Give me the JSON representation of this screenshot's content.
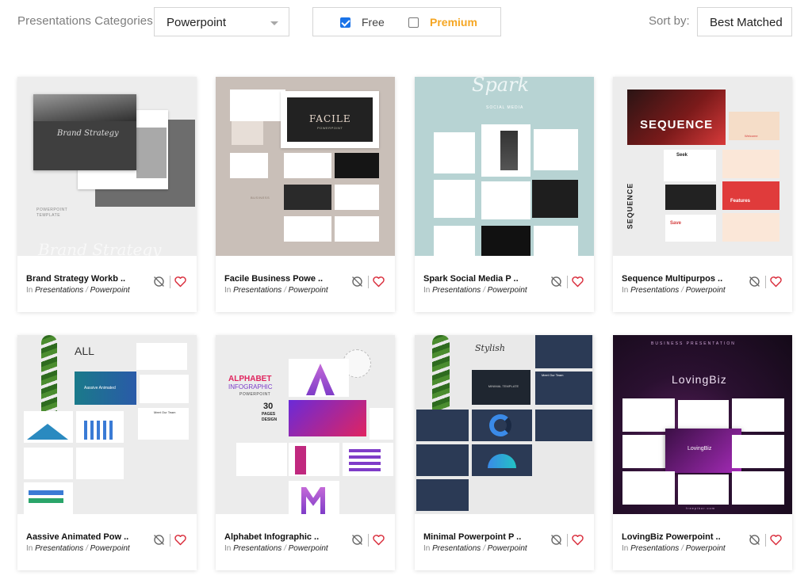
{
  "filters": {
    "category_label": "Presentations Categories",
    "category_value": "Powerpoint",
    "free_label": "Free",
    "free_checked": true,
    "premium_label": "Premium",
    "premium_checked": false,
    "premium_color": "#f5a623",
    "checkbox_color": "#1a73e8",
    "sort_label": "Sort by:",
    "sort_value": "Best Matched"
  },
  "cards": [
    {
      "title": "Brand Strategy Workb ..",
      "in_label": "In",
      "category": "Presentations",
      "separator": "/",
      "subcategory": "Powerpoint",
      "thumb": {
        "bg": "#ededed",
        "cover_script": "Brand Strategy",
        "tag_lines": [
          "POWERPOINT",
          "TEMPLATE"
        ],
        "watermark": "Brand Strategy"
      }
    },
    {
      "title": "Facile Business Powe ..",
      "in_label": "In",
      "category": "Presentations",
      "separator": "/",
      "subcategory": "Powerpoint",
      "thumb": {
        "bg": "#c9bfb8",
        "cover_title": "FACILE",
        "cover_sub": "POWERPOINT",
        "label": "BUSINESS"
      }
    },
    {
      "title": "Spark Social Media P ..",
      "in_label": "In",
      "category": "Presentations",
      "separator": "/",
      "subcategory": "Powerpoint",
      "thumb": {
        "bg": "#b7d3d3",
        "cover_title": "Spark",
        "cover_sub": "SOCIAL MEDIA"
      }
    },
    {
      "title": "Sequence Multipurpos ..",
      "in_label": "In",
      "category": "Presentations",
      "separator": "/",
      "subcategory": "Powerpoint",
      "thumb": {
        "bg": "#ececec",
        "cover_title": "SEQUENCE",
        "vertical": "SEQUENCE",
        "slide_words": [
          "Seek",
          "Save",
          "Features",
          "Welcome"
        ]
      }
    },
    {
      "title": "Aassive Animated Pow ..",
      "in_label": "In",
      "category": "Presentations",
      "separator": "/",
      "subcategory": "Powerpoint",
      "thumb": {
        "bg": "#ececec",
        "cover_title": "ALL",
        "slide_words": [
          "Aassive Animated",
          "Meet Our Team"
        ]
      }
    },
    {
      "title": "Alphabet Infographic ..",
      "in_label": "In",
      "category": "Presentations",
      "separator": "/",
      "subcategory": "Powerpoint",
      "thumb": {
        "bg": "#ececec",
        "cover_title": "ALPHABET",
        "cover_title2": "INFOGRAPHIC",
        "cover_sub": "POWERPOINT",
        "pages": "30",
        "pages_l1": "PAGES",
        "pages_l2": "DESIGN"
      }
    },
    {
      "title": "Minimal Powerpoint P ..",
      "in_label": "In",
      "category": "Presentations",
      "separator": "/",
      "subcategory": "Powerpoint",
      "thumb": {
        "bg": "#e9e9e9",
        "cover_script": "Stylish",
        "cover_sub": "MINIMAL TEMPLATE",
        "slide_words": [
          "Meet Our Team"
        ]
      }
    },
    {
      "title": "LovingBiz Powerpoint ..",
      "in_label": "In",
      "category": "Presentations",
      "separator": "/",
      "subcategory": "Powerpoint",
      "thumb": {
        "bg": "#1c0d23",
        "top_line": "BUSINESS PRESENTATION",
        "cover_title": "LovingBiz",
        "center": "LovingBiz",
        "footer": "freepikor.com"
      }
    }
  ]
}
